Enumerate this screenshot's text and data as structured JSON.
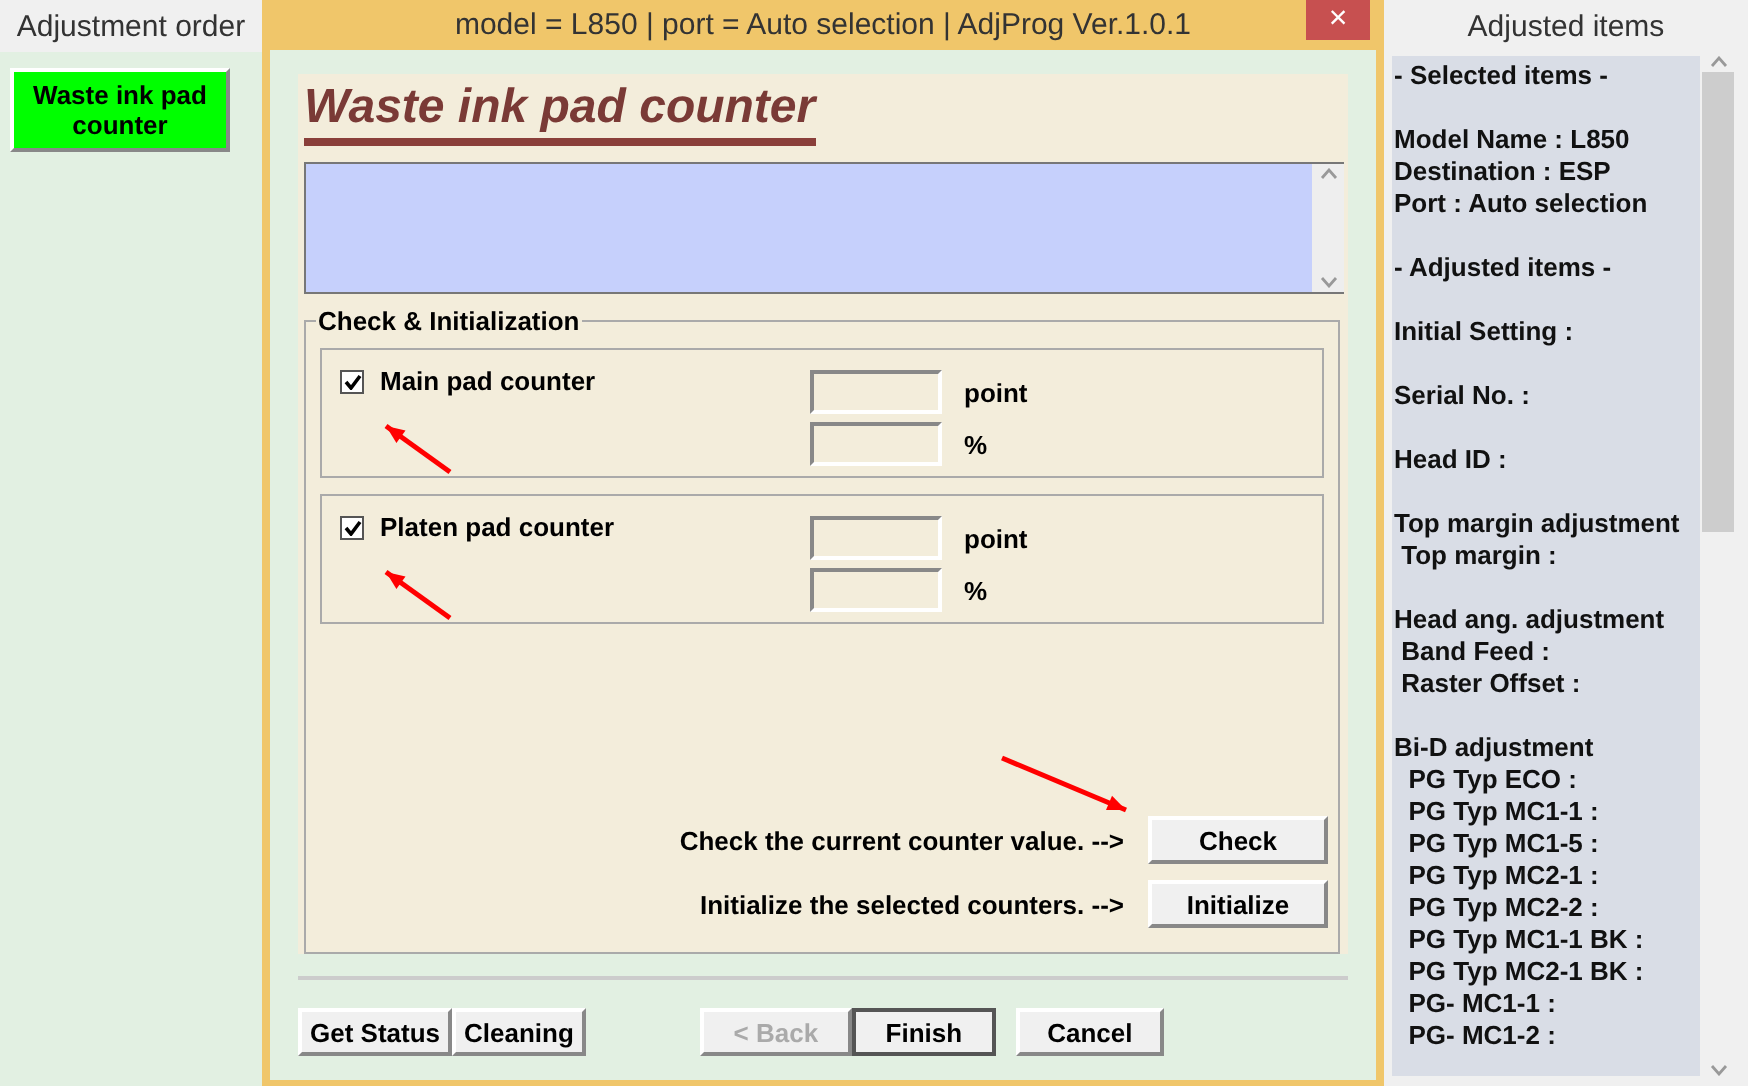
{
  "left_panel": {
    "title": "Adjustment order",
    "items": [
      {
        "label": "Waste ink pad counter",
        "selected": true
      }
    ]
  },
  "window": {
    "title": "model = L850 | port = Auto selection | AdjProg Ver.1.0.1",
    "close": "×"
  },
  "page": {
    "heading": "Waste ink pad counter",
    "group": {
      "title": "Check & Initialization",
      "counters": [
        {
          "label": "Main pad counter",
          "checked": true,
          "unit_1": "point",
          "unit_2": "%"
        },
        {
          "label": "Platen pad counter",
          "checked": true,
          "unit_1": "point",
          "unit_2": "%"
        }
      ],
      "actions": [
        {
          "text": "Check the current counter value. -->",
          "button": "Check"
        },
        {
          "text": "Initialize the selected counters. -->",
          "button": "Initialize"
        }
      ]
    }
  },
  "buttons": [
    {
      "label": "Get Status",
      "disabled": false,
      "default": false
    },
    {
      "label": "Cleaning",
      "disabled": false,
      "default": false
    },
    {
      "label": "< Back",
      "disabled": true,
      "default": false
    },
    {
      "label": "Finish",
      "disabled": false,
      "default": true
    },
    {
      "label": "Cancel",
      "disabled": false,
      "default": false
    }
  ],
  "right_panel": {
    "title": "Adjusted items",
    "groups": [
      [
        "- Selected items -"
      ],
      [
        "Model Name : L850",
        "Destination : ESP",
        "Port : Auto selection"
      ],
      [
        "- Adjusted items -"
      ],
      [
        "Initial Setting :"
      ],
      [
        "Serial No. :"
      ],
      [
        "Head ID :"
      ],
      [
        "Top margin adjustment",
        " Top margin :"
      ],
      [
        "Head ang. adjustment",
        " Band Feed :",
        " Raster Offset :"
      ],
      [
        "Bi-D adjustment",
        "  PG Typ ECO :",
        "  PG Typ MC1-1 :",
        "  PG Typ MC1-5 :",
        "  PG Typ MC2-1 :",
        "  PG Typ MC2-2 :",
        "  PG Typ MC1-1 BK :",
        "  PG Typ MC2-1 BK :",
        "  PG- MC1-1 :",
        "  PG- MC1-2 :"
      ]
    ]
  }
}
